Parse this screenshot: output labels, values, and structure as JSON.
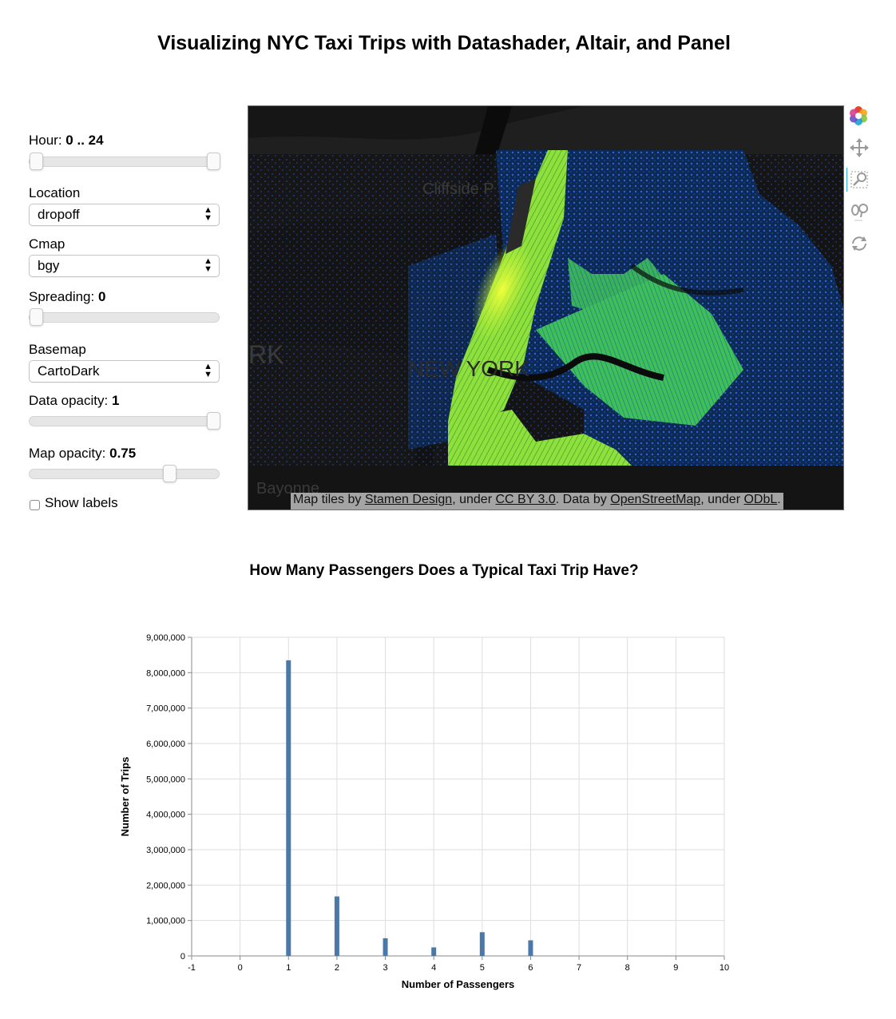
{
  "app_title": "Visualizing NYC Taxi Trips with Datashader, Altair, and Panel",
  "controls": {
    "hour": {
      "label": "Hour: ",
      "value": "0 .. 24",
      "start": 0,
      "end": 24,
      "min": 0,
      "max": 24
    },
    "location": {
      "label": "Location",
      "value": "dropoff"
    },
    "cmap": {
      "label": "Cmap",
      "value": "bgy"
    },
    "spreading": {
      "label": "Spreading: ",
      "value": "0",
      "fraction": 0
    },
    "basemap": {
      "label": "Basemap",
      "value": "CartoDark"
    },
    "data_opacity": {
      "label": "Data opacity: ",
      "value": "1",
      "fraction": 1
    },
    "map_opacity": {
      "label": "Map opacity: ",
      "value": "0.75",
      "fraction": 0.75
    },
    "show_labels": {
      "label": "Show labels",
      "checked": false
    }
  },
  "map": {
    "labels": {
      "cliffside": "Cliffside P",
      "bayonne": "Bayonne",
      "rk": "RK",
      "ny": "NEW YORK"
    },
    "attribution": {
      "p1": "Map tiles by ",
      "l1": "Stamen Design",
      "p2": ", under ",
      "l2": "CC BY 3.0",
      "p3": ". Data by ",
      "l3": "OpenStreetMap",
      "p4": ", under ",
      "l4": "ODbL",
      "p5": "."
    },
    "tools": [
      "bokeh-logo-icon",
      "pan-icon",
      "box-zoom-icon",
      "wheel-zoom-icon",
      "reset-icon"
    ]
  },
  "chart_title": "How Many Passengers Does a Typical Taxi Trip Have?",
  "chart_data": {
    "type": "bar",
    "x": [
      1,
      2,
      3,
      4,
      5,
      6
    ],
    "values": [
      8350000,
      1680000,
      500000,
      240000,
      670000,
      440000
    ],
    "xlabel": "Number of Passengers",
    "ylabel": "Number of Trips",
    "xlim": [
      -1,
      10
    ],
    "ylim": [
      0,
      9000000
    ],
    "x_ticks": [
      "-1",
      "0",
      "1",
      "2",
      "3",
      "4",
      "5",
      "6",
      "7",
      "8",
      "9",
      "10"
    ],
    "y_ticks": [
      "0",
      "1,000,000",
      "2,000,000",
      "3,000,000",
      "4,000,000",
      "5,000,000",
      "6,000,000",
      "7,000,000",
      "8,000,000",
      "9,000,000"
    ],
    "grid": true,
    "colors": {
      "bar": "#4c78a8",
      "grid": "#dddddd",
      "axis": "#888888"
    }
  }
}
